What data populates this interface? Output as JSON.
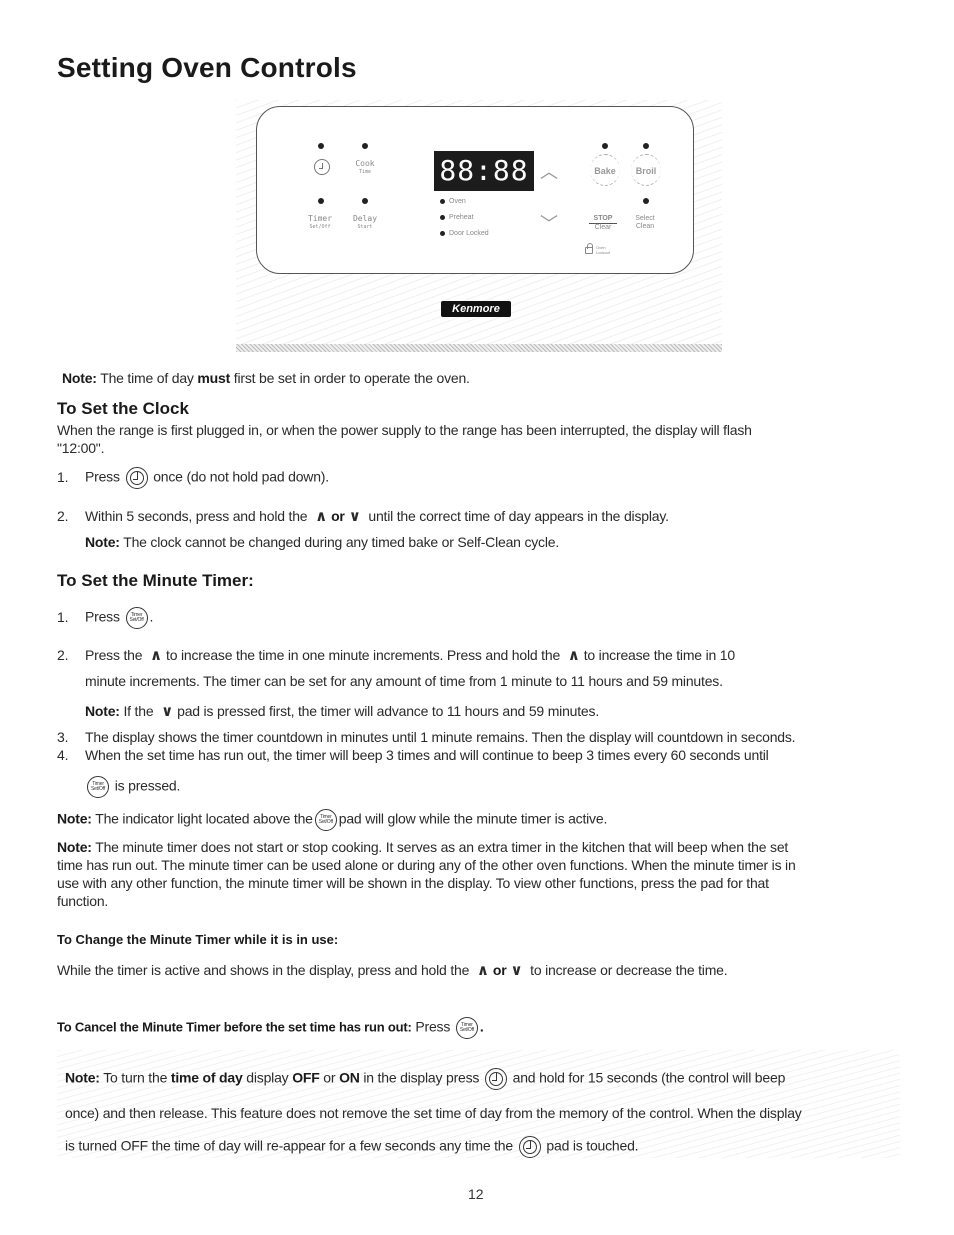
{
  "page": {
    "title": "Setting Oven Controls",
    "page_number": "12"
  },
  "control_panel": {
    "clock_pad": "clock-icon",
    "cook_time": {
      "line1": "Cook",
      "line2": "Time"
    },
    "timer": {
      "line1": "Timer",
      "line2": "Set/Off"
    },
    "delay_start": {
      "line1": "Delay",
      "line2": "Start"
    },
    "display_value": "88:88",
    "indicators": [
      "Oven",
      "Preheat",
      "Door Locked"
    ],
    "up_arrow": "chevron-up-icon",
    "down_arrow": "chevron-down-icon",
    "bake": "Bake",
    "broil": "Broil",
    "stop": {
      "line1": "STOP",
      "line2": "Clear"
    },
    "select": {
      "line1": "Select",
      "line2": "Clean"
    },
    "oven_lockout": {
      "line1": "Oven",
      "line2": "Lockout"
    },
    "brand": "Kenmore"
  },
  "note_top": {
    "label": "Note:",
    "pre": "The time of day",
    "bold": "must",
    "post": "first be set in order to operate the oven."
  },
  "clock_section": {
    "heading": "To Set the Clock",
    "intro_line1": "When the range is first plugged in, or when the power supply to the range has been interrupted, the display will flash",
    "intro_line2": "\"12:00\".",
    "step1": {
      "num": "1.",
      "pre": "Press",
      "post": "once (do not hold pad down)."
    },
    "step2": {
      "num": "2.",
      "pre": "Within 5 seconds, press and hold the",
      "or": "or",
      "post": "until the correct time of day appears in the display."
    },
    "note": {
      "label": "Note:",
      "text": "The clock cannot be changed during any timed bake or Self-Clean cycle."
    }
  },
  "timer_section": {
    "heading": "To Set the Minute Timer:",
    "step1": {
      "num": "1.",
      "pre": "Press",
      "post": "."
    },
    "step2": {
      "num": "2.",
      "a": "Press the",
      "b": "to increase the time in one minute increments. Press and hold the",
      "c": "to increase the time in 10",
      "line2": "minute increments. The timer can be set for any amount of time from 1 minute to 11 hours and 59 minutes."
    },
    "note1": {
      "label": "Note:",
      "pre": "If the",
      "post": "pad is pressed first, the timer will advance to 11 hours and 59 minutes."
    },
    "step3": {
      "num": "3.",
      "text": "The display shows the timer countdown in minutes until 1 minute remains. Then the display will countdown in seconds."
    },
    "step4": {
      "num": "4.",
      "text": "When the set time has run out, the timer will beep 3 times and will continue to beep 3 times every 60 seconds until",
      "line2": "is pressed."
    },
    "note2": {
      "label": "Note:",
      "pre": "The indicator light located above the",
      "post": "pad will glow while the minute timer is active."
    },
    "note3": {
      "label": "Note:",
      "lines": [
        "The minute timer does not start or stop cooking. It serves as an extra timer in the kitchen that will beep when the set",
        "time has run out. The minute timer can be used alone or during any of the other oven functions. When the minute timer is in",
        "use with any other function, the minute timer will be shown in the display. To view other functions, press the pad for that",
        "function."
      ]
    }
  },
  "change_timer": {
    "heading": "To Change the Minute Timer while it is in use:",
    "pre": "While the timer is active and shows in the display, press and hold the",
    "or": "or",
    "post": "to increase or decrease the time."
  },
  "cancel_timer": {
    "heading": "To Cancel the Minute Timer before the set time has run out:",
    "press": "Press",
    "end": "."
  },
  "note_bottom": {
    "label": "Note:",
    "l1_a": "To turn the",
    "l1_bold1": "time of day",
    "l1_b": "display",
    "l1_bold2": "OFF",
    "l1_c": "or",
    "l1_bold3": "ON",
    "l1_d": "in the display press",
    "l1_e": "and hold for 15 seconds (the control will beep",
    "l2": "once) and then release. This feature does not remove the set time of day from the memory of the control. When the display",
    "l3_a": "is turned OFF the time of day will re-appear for a few seconds any time the",
    "l3_b": "pad is touched."
  },
  "timer_pad_text": {
    "line1": "Timer",
    "line2": "Set/Off"
  }
}
